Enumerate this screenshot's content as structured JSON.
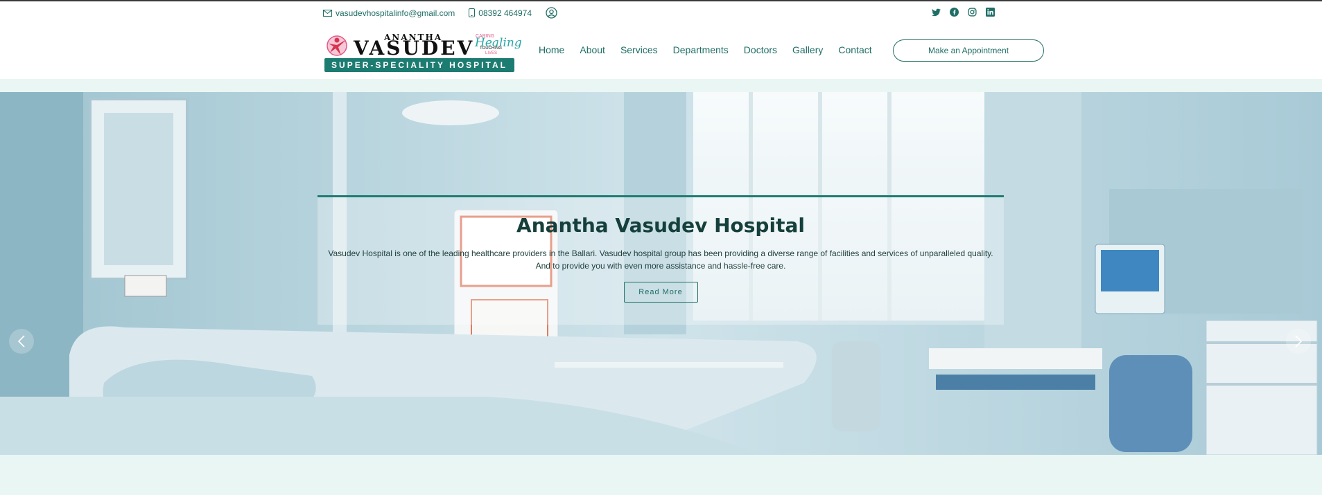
{
  "topbar": {
    "email": "vasudevhospitalinfo@gmail.com",
    "phone": "08392 464974",
    "icons": {
      "email": "envelope-icon",
      "phone": "phone-icon",
      "account": "user-circle-icon"
    },
    "social": [
      "twitter-icon",
      "facebook-icon",
      "instagram-icon",
      "linkedin-icon"
    ]
  },
  "logo": {
    "top": "ANANTHA",
    "name": "VASUDEV",
    "tagline_small": "CARING",
    "tagline_main": "Healing",
    "tagline_sub1": "TOUCHING",
    "tagline_sub2": "LIVES",
    "band": "SUPER-SPECIALITY HOSPITAL"
  },
  "nav": {
    "items": [
      "Home",
      "About",
      "Services",
      "Departments",
      "Doctors",
      "Gallery",
      "Contact"
    ],
    "cta": "Make an Appointment"
  },
  "hero": {
    "title": "Anantha Vasudev Hospital",
    "description_line1": "Vasudev Hospital is one of the leading healthcare providers in the Ballari. Vasudev hospital group has been providing a diverse range of facilities and services of unparalleled quality.",
    "description_line2": "And to provide you with even more assistance and hassle-free care.",
    "button": "Read More",
    "prev_icon": "chevron-left-icon",
    "next_icon": "chevron-right-icon"
  },
  "colors": {
    "accent": "#1d7c71",
    "text": "#1f6e66",
    "page_bg": "#eaf6f4",
    "heading": "#153f3a"
  }
}
